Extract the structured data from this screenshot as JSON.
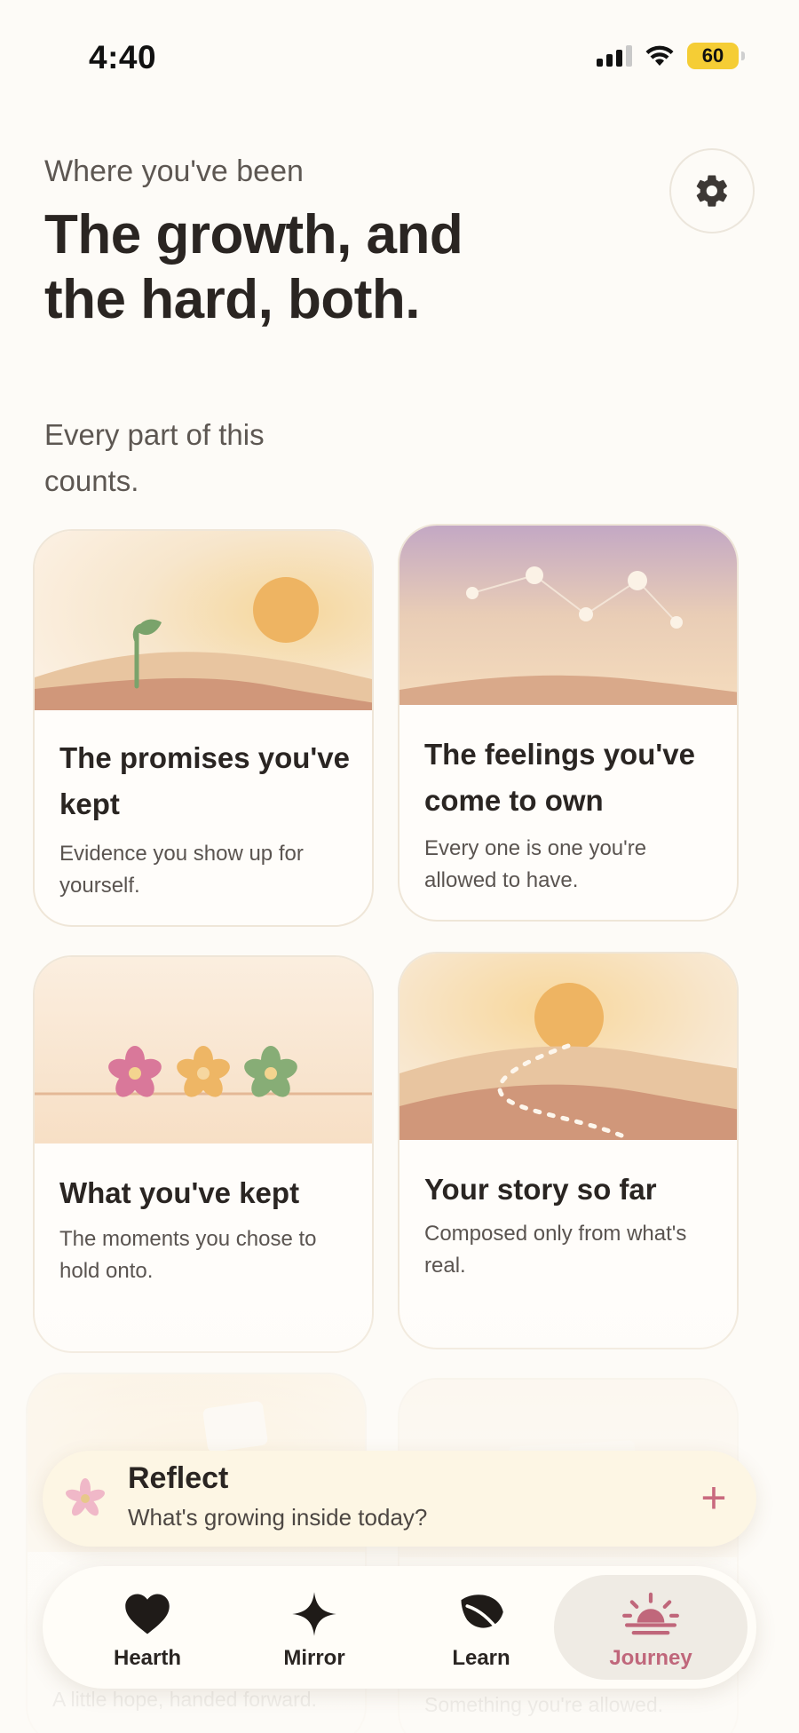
{
  "status_bar": {
    "time": "4:40",
    "battery": "60"
  },
  "header": {
    "eyebrow": "Where you've been",
    "headline": "The growth, and the hard, both.",
    "subline": "Every part of this counts."
  },
  "cards": [
    {
      "title": "The promises you've kept",
      "desc": "Evidence you show up for yourself."
    },
    {
      "title": "The feelings you've come to own",
      "desc": "Every one is one you're allowed to have."
    },
    {
      "title": "What you've kept",
      "desc": "The moments you chose to hold onto."
    },
    {
      "title": "Your story so far",
      "desc": "Composed only from what's real."
    },
    {
      "title": "",
      "desc": "A little hope, handed forward."
    },
    {
      "title": "",
      "desc": "Something you're allowed."
    }
  ],
  "reflect": {
    "title": "Reflect",
    "subtitle": "What's growing inside today?"
  },
  "tabs": [
    {
      "label": "Hearth",
      "icon": "heart-icon"
    },
    {
      "label": "Mirror",
      "icon": "sparkle-icon"
    },
    {
      "label": "Learn",
      "icon": "leaf-icon"
    },
    {
      "label": "Journey",
      "icon": "sunrise-icon",
      "active": true
    }
  ],
  "colors": {
    "accent": "#c0677b",
    "sun": "#edb25e",
    "background": "#fdfbf7"
  }
}
